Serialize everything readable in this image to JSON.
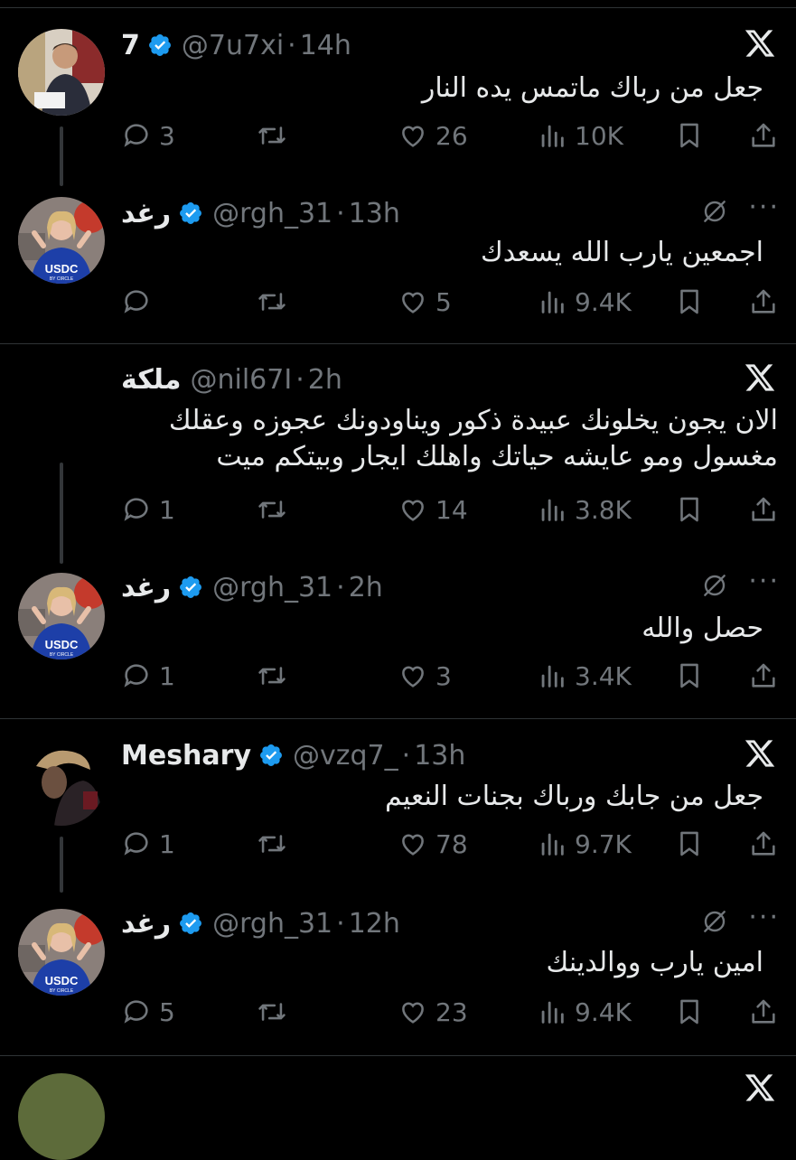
{
  "colors": {
    "background": "#000000",
    "text": "#e7e9ea",
    "muted": "#71767b",
    "verified": "#1d9bf0",
    "divider": "#2f3336"
  },
  "icons": [
    "x-logo-icon",
    "grok-icon",
    "more-icon",
    "verified-icon",
    "reply-icon",
    "retweet-icon",
    "like-icon",
    "views-icon",
    "bookmark-icon",
    "share-icon"
  ],
  "tweets": [
    {
      "name": "7",
      "handle": "@7u7xi",
      "time": "14h",
      "text": "جعل من رباك ماتمس يده النار",
      "replies": "3",
      "retweets": "",
      "likes": "26",
      "views": "10K",
      "verified": true,
      "avatar": "man-avatar"
    },
    {
      "name": "رغد",
      "handle": "@rgh_31",
      "time": "13h",
      "text": "اجمعين يارب الله يسعدك",
      "replies": "",
      "retweets": "",
      "likes": "5",
      "views": "9.4K",
      "verified": true,
      "avatar": "usdc-avatar"
    },
    {
      "name": "ملكة",
      "handle": "@nil67I",
      "time": "2h",
      "text": "الان يجون يخلونك عبيدة ذكور ويناودونك عجوزه وعقلك\nمغسول ومو عايشه حياتك واهلك ايجار وبيتكم ميت",
      "replies": "1",
      "retweets": "",
      "likes": "14",
      "views": "3.8K",
      "verified": false,
      "avatar": "none"
    },
    {
      "name": "رغد",
      "handle": "@rgh_31",
      "time": "2h",
      "text": "حصل والله",
      "replies": "1",
      "retweets": "",
      "likes": "3",
      "views": "3.4K",
      "verified": true,
      "avatar": "usdc-avatar"
    },
    {
      "name": "Meshary",
      "handle": "@vzq7_",
      "time": "13h",
      "text": "جعل من جابك ورباك بجنات النعيم",
      "replies": "1",
      "retweets": "",
      "likes": "78",
      "views": "9.7K",
      "verified": true,
      "avatar": "profile-avatar"
    },
    {
      "name": "رغد",
      "handle": "@rgh_31",
      "time": "12h",
      "text": "امين يارب ووالدينك",
      "replies": "5",
      "retweets": "",
      "likes": "23",
      "views": "9.4K",
      "verified": true,
      "avatar": "usdc-avatar"
    }
  ],
  "usdc_text": "USDC",
  "usdc_sub": "BY CIRCLE"
}
